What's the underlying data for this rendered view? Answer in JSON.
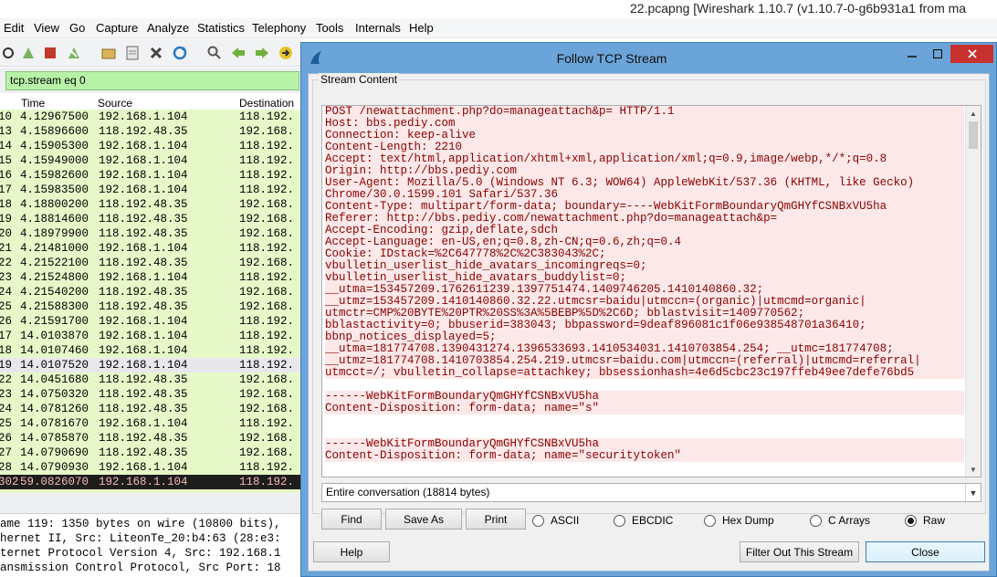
{
  "window_title": "22.pcapng   [Wireshark 1.10.7  (v1.10.7-0-g6b931a1 from ma",
  "menu": [
    "Edit",
    "View",
    "Go",
    "Capture",
    "Analyze",
    "Statistics",
    "Telephony",
    "Tools",
    "Internals",
    "Help"
  ],
  "filter": {
    "value": "tcp.stream eq 0"
  },
  "packet_columns": {
    "time": "Time",
    "source": "Source",
    "destination": "Destination"
  },
  "packets": [
    {
      "no": "10",
      "time": "4.12967500",
      "src": "192.168.1.104",
      "dst": "118.192.",
      "bg": "#e7f8c8"
    },
    {
      "no": "13",
      "time": "4.15896600",
      "src": "118.192.48.35",
      "dst": "192.168.",
      "bg": "#e7f8c8"
    },
    {
      "no": "14",
      "time": "4.15905300",
      "src": "192.168.1.104",
      "dst": "118.192.",
      "bg": "#e7f8c8"
    },
    {
      "no": "15",
      "time": "4.15949000",
      "src": "192.168.1.104",
      "dst": "118.192.",
      "bg": "#e7f8c8"
    },
    {
      "no": "16",
      "time": "4.15982600",
      "src": "192.168.1.104",
      "dst": "118.192.",
      "bg": "#e7f8c8"
    },
    {
      "no": "17",
      "time": "4.15983500",
      "src": "192.168.1.104",
      "dst": "118.192.",
      "bg": "#e7f8c8"
    },
    {
      "no": "18",
      "time": "4.18800200",
      "src": "118.192.48.35",
      "dst": "192.168.",
      "bg": "#e7f8c8"
    },
    {
      "no": "19",
      "time": "4.18814600",
      "src": "118.192.48.35",
      "dst": "192.168.",
      "bg": "#e7f8c8"
    },
    {
      "no": "20",
      "time": "4.18979900",
      "src": "118.192.48.35",
      "dst": "192.168.",
      "bg": "#e7f8c8"
    },
    {
      "no": "21",
      "time": "4.21481000",
      "src": "192.168.1.104",
      "dst": "118.192.",
      "bg": "#e7f8c8"
    },
    {
      "no": "22",
      "time": "4.21522100",
      "src": "118.192.48.35",
      "dst": "192.168.",
      "bg": "#e7f8c8"
    },
    {
      "no": "23",
      "time": "4.21524800",
      "src": "192.168.1.104",
      "dst": "118.192.",
      "bg": "#e7f8c8"
    },
    {
      "no": "24",
      "time": "4.21540200",
      "src": "118.192.48.35",
      "dst": "192.168.",
      "bg": "#e7f8c8"
    },
    {
      "no": "25",
      "time": "4.21588300",
      "src": "118.192.48.35",
      "dst": "192.168.",
      "bg": "#e7f8c8"
    },
    {
      "no": "26",
      "time": "4.21591700",
      "src": "192.168.1.104",
      "dst": "118.192.",
      "bg": "#e7f8c8"
    },
    {
      "no": "17",
      "time": "14.0103870",
      "src": "192.168.1.104",
      "dst": "118.192.",
      "bg": "#e7f8c8"
    },
    {
      "no": "18",
      "time": "14.0107460",
      "src": "192.168.1.104",
      "dst": "118.192.",
      "bg": "#e7f8c8"
    },
    {
      "no": "19",
      "time": "14.0107520",
      "src": "192.168.1.104",
      "dst": "118.192.",
      "bg": "#e8e8ec"
    },
    {
      "no": "22",
      "time": "14.0451680",
      "src": "118.192.48.35",
      "dst": "192.168.",
      "bg": "#e7f8c8"
    },
    {
      "no": "23",
      "time": "14.0750320",
      "src": "118.192.48.35",
      "dst": "192.168.",
      "bg": "#e7f8c8"
    },
    {
      "no": "24",
      "time": "14.0781260",
      "src": "118.192.48.35",
      "dst": "192.168.",
      "bg": "#e7f8c8"
    },
    {
      "no": "25",
      "time": "14.0781670",
      "src": "192.168.1.104",
      "dst": "118.192.",
      "bg": "#e7f8c8"
    },
    {
      "no": "26",
      "time": "14.0785870",
      "src": "118.192.48.35",
      "dst": "192.168.",
      "bg": "#e7f8c8"
    },
    {
      "no": "27",
      "time": "14.0790690",
      "src": "118.192.48.35",
      "dst": "192.168.",
      "bg": "#e7f8c8"
    },
    {
      "no": "28",
      "time": "14.0790930",
      "src": "192.168.1.104",
      "dst": "118.192.",
      "bg": "#e7f8c8"
    },
    {
      "no": "302",
      "time": "59.0826070",
      "src": "192.168.1.104",
      "dst": "118.192.",
      "bg": "#1d1d1d",
      "fg": "#f7b7b7"
    }
  ],
  "details": [
    "ame 119: 1350 bytes on wire (10800 bits),",
    "hernet II, Src: LiteonTe_20:b4:63 (28:e3:",
    "ternet Protocol Version 4, Src: 192.168.1",
    "ansmission Control Protocol, Src Port: 18"
  ],
  "dialog": {
    "title": "Follow TCP Stream",
    "group_label": "Stream Content",
    "conversation": "Entire conversation (18814 bytes)",
    "buttons": {
      "find": "Find",
      "save_as": "Save As",
      "print": "Print",
      "help": "Help",
      "filter_out": "Filter Out This Stream",
      "close": "Close"
    },
    "formats": [
      "ASCII",
      "EBCDIC",
      "Hex Dump",
      "C Arrays",
      "Raw"
    ],
    "selected_format": "Raw",
    "stream_lines": [
      "POST /newattachment.php?do=manageattach&p= HTTP/1.1",
      "Host: bbs.pediy.com",
      "Connection: keep-alive",
      "Content-Length: 2210",
      "Accept: text/html,application/xhtml+xml,application/xml;q=0.9,image/webp,*/*;q=0.8",
      "Origin: http://bbs.pediy.com",
      "User-Agent: Mozilla/5.0 (Windows NT 6.3; WOW64) AppleWebKit/537.36 (KHTML, like Gecko)",
      "Chrome/30.0.1599.101 Safari/537.36",
      "Content-Type: multipart/form-data; boundary=----WebKitFormBoundaryQmGHYfCSNBxVU5ha",
      "Referer: http://bbs.pediy.com/newattachment.php?do=manageattach&p=",
      "Accept-Encoding: gzip,deflate,sdch",
      "Accept-Language: en-US,en;q=0.8,zh-CN;q=0.6,zh;q=0.4",
      "Cookie: IDstack=%2C647778%2C%2C383043%2C;",
      "vbulletin_userlist_hide_avatars_incomingreqs=0;",
      "vbulletin_userlist_hide_avatars_buddylist=0;",
      "__utma=153457209.1762611239.1397751474.1409746205.1410140860.32;",
      "__utmz=153457209.1410140860.32.22.utmcsr=baidu|utmccn=(organic)|utmcmd=organic|",
      "utmctr=CMP%20BYTE%20PTR%20SS%3A%5BEBP%5D%2C6D; bblastvisit=1409770562;",
      "bblastactivity=0; bbuserid=383043; bbpassword=9deaf896081c1f06e938548701a36410;",
      "bbnp_notices_displayed=5;",
      "__utma=181774708.1390431274.1396533693.1410534031.1410703854.254; __utmc=181774708;",
      "__utmz=181774708.1410703854.254.219.utmcsr=baidu.com|utmccn=(referral)|utmcmd=referral|",
      "utmcct=/; vbulletin_collapse=attachkey; bbsessionhash=4e6d5cbc23c197ffeb49ee7defe76bd5",
      "",
      "------WebKitFormBoundaryQmGHYfCSNBxVU5ha",
      "Content-Disposition: form-data; name=\"s\"",
      "",
      "",
      "------WebKitFormBoundaryQmGHYfCSNBxVU5ha",
      "Content-Disposition: form-data; name=\"securitytoken\""
    ]
  }
}
